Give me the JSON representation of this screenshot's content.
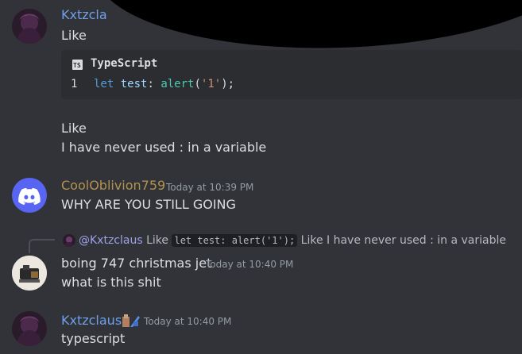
{
  "colors": {
    "background": "#313338",
    "kxtzclaus_name": "#6fa0e8",
    "cooloblivion_name": "#b3924d",
    "boing_name": "#dbdee1",
    "timestamp": "#949ba4",
    "discord_blurple": "#5865f2"
  },
  "messages": {
    "m1": {
      "author": "Kxtzcla",
      "text1": "Like",
      "code": {
        "language": "TypeScript",
        "language_icon": "TS",
        "line_number": "1",
        "tokens": {
          "kw": "let",
          "var": "test",
          "colon": ": ",
          "fn": "alert",
          "open": "(",
          "str": "'1'",
          "close": ");"
        }
      },
      "text2": "Like",
      "text3": "I have never used  : in a variable"
    },
    "m2": {
      "author": "CoolOblivion759",
      "timestamp": "Today at 10:39 PM",
      "text": "WHY ARE YOU STILL GOING"
    },
    "m3": {
      "reply": {
        "mention": "@Kxtzclaus",
        "text_before": "Like",
        "code": "let test: alert('1');",
        "text_after": "Like I have never used : in a variable"
      },
      "author": "boing 747 christmas jet",
      "timestamp": "Today at 10:40 PM",
      "text": "what is this shit"
    },
    "m4": {
      "author": "Kxtzclaus",
      "timestamp": "Today at 10:40 PM",
      "text": "typescript"
    }
  }
}
